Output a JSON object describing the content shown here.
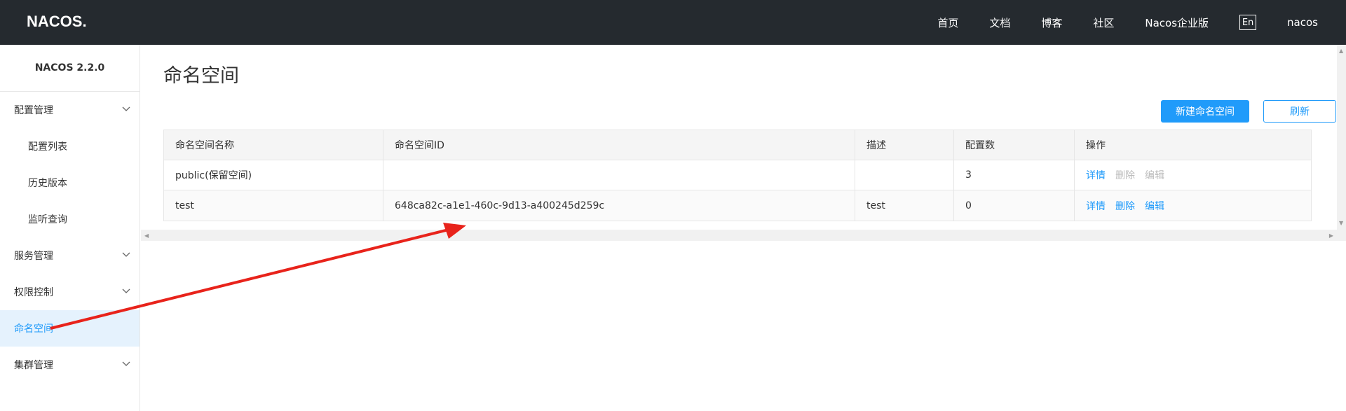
{
  "topbar": {
    "logo_text": "NACOS.",
    "nav": [
      "首页",
      "文档",
      "博客",
      "社区",
      "Nacos企业版"
    ],
    "lang": "En",
    "user": "nacos"
  },
  "sidebar": {
    "version": "NACOS 2.2.0",
    "items": [
      {
        "label": "配置管理",
        "expandable": true
      },
      {
        "label": "配置列表",
        "sub": true
      },
      {
        "label": "历史版本",
        "sub": true
      },
      {
        "label": "监听查询",
        "sub": true
      },
      {
        "label": "服务管理",
        "expandable": true
      },
      {
        "label": "权限控制",
        "expandable": true
      },
      {
        "label": "命名空间",
        "active": true
      },
      {
        "label": "集群管理",
        "expandable": true
      }
    ]
  },
  "main": {
    "title": "命名空间",
    "buttons": {
      "create": "新建命名空间",
      "refresh": "刷新"
    },
    "table": {
      "headers": [
        "命名空间名称",
        "命名空间ID",
        "描述",
        "配置数",
        "操作"
      ],
      "rows": [
        {
          "name": "public(保留空间)",
          "id": "",
          "desc": "",
          "count": "3",
          "ops": [
            "详情",
            "删除",
            "编辑"
          ],
          "ops_disabled": [
            false,
            true,
            true
          ]
        },
        {
          "name": "test",
          "id": "648ca82c-a1e1-460c-9d13-a400245d259c",
          "desc": "test",
          "count": "0",
          "ops": [
            "详情",
            "删除",
            "编辑"
          ],
          "ops_disabled": [
            false,
            false,
            false
          ]
        }
      ]
    }
  },
  "colors": {
    "topbar": "#252a2f",
    "accent": "#209bfa",
    "annotation_arrow": "#e8231b"
  }
}
